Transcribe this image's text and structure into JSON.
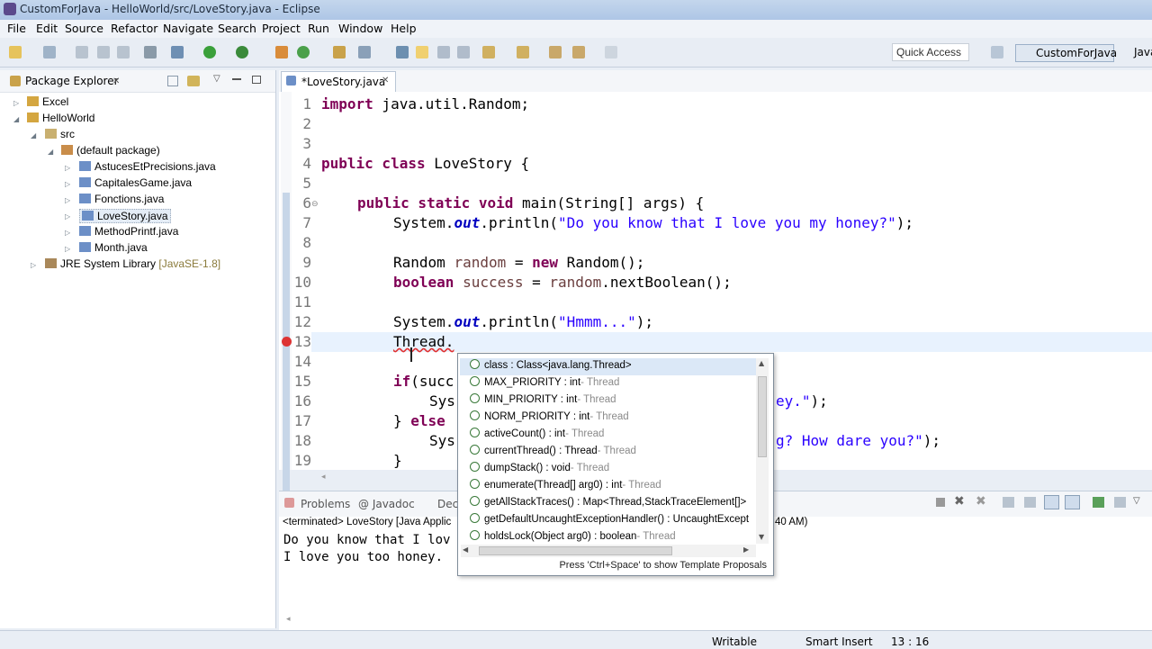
{
  "window": {
    "title": "CustomForJava - HelloWorld/src/LoveStory.java - Eclipse"
  },
  "menu": [
    "File",
    "Edit",
    "Source",
    "Refactor",
    "Navigate",
    "Search",
    "Project",
    "Run",
    "Window",
    "Help"
  ],
  "toolbar": {
    "quick_access": "Quick Access",
    "perspective_active": "CustomForJava",
    "perspective_other": "Java"
  },
  "package_explorer": {
    "tab": "Package Explorer",
    "items": [
      "Excel",
      "HelloWorld",
      "src",
      "(default package)",
      "AstucesEtPrecisions.java",
      "CapitalesGame.java",
      "Fonctions.java",
      "LoveStory.java",
      "MethodPrintf.java",
      "Month.java",
      "JRE System Library"
    ],
    "jre_suffix": "[JavaSE-1.8]"
  },
  "editor": {
    "tab": "*LoveStory.java",
    "line_numbers": [
      "1",
      "2",
      "3",
      "4",
      "5",
      "6",
      "7",
      "8",
      "9",
      "10",
      "11",
      "12",
      "13",
      "14",
      "15",
      "16",
      "17",
      "18",
      "19"
    ],
    "code": {
      "l1_kw": "import",
      "l1_rest": " java.util.Random;",
      "l4_kw": "public class",
      "l4_rest": " LoveStory {",
      "l6_kw": "public static void",
      "l6_rest": " main(String[] args) {",
      "l7_a": "System.",
      "l7_f": "out",
      "l7_b": ".println(",
      "l7_s": "\"Do you know that I love you my honey?\"",
      "l7_c": ");",
      "l9_a": "Random ",
      "l9_v": "random",
      "l9_b": " = ",
      "l9_kw": "new",
      "l9_c": " Random();",
      "l10_kw": "boolean",
      "l10_v": " success",
      "l10_b": " = ",
      "l10_v2": "random",
      "l10_c": ".nextBoolean();",
      "l12_a": "System.",
      "l12_f": "out",
      "l12_b": ".println(",
      "l12_s": "\"Hmmm...\"",
      "l12_c": ");",
      "l13": "Thread.",
      "l15_kw": "if",
      "l15_rest": "(succ",
      "l16_a": "Sys",
      "l16_s": "ey.\"",
      "l16_c": ");",
      "l17_a": "} ",
      "l17_kw": "else",
      "l18_a": "Sys",
      "l18_s": "g? How dare you?\"",
      "l18_c": ");",
      "l19": "}"
    }
  },
  "bottom_panel": {
    "tabs": [
      "Problems",
      "@ Javadoc",
      "Decl"
    ],
    "terminated": "<terminated> LoveStory [Java Applic",
    "terminated_tail": "40 AM)",
    "console_lines": [
      "Do you know that I lov",
      "I love you too honey."
    ]
  },
  "autocomplete": {
    "items": [
      {
        "label": "class : Class<java.lang.Thread>",
        "owner": ""
      },
      {
        "label": "MAX_PRIORITY : int",
        "owner": " - Thread"
      },
      {
        "label": "MIN_PRIORITY : int",
        "owner": " - Thread"
      },
      {
        "label": "NORM_PRIORITY : int",
        "owner": " - Thread"
      },
      {
        "label": "activeCount() : int",
        "owner": " - Thread"
      },
      {
        "label": "currentThread() : Thread",
        "owner": " - Thread"
      },
      {
        "label": "dumpStack() : void",
        "owner": " - Thread"
      },
      {
        "label": "enumerate(Thread[] arg0) : int",
        "owner": " - Thread"
      },
      {
        "label": "getAllStackTraces() : Map<Thread,StackTraceElement[]>",
        "owner": ""
      },
      {
        "label": "getDefaultUncaughtExceptionHandler() : UncaughtExcept",
        "owner": ""
      },
      {
        "label": "holdsLock(Object arg0) : boolean",
        "owner": " - Thread"
      }
    ],
    "hint": "Press 'Ctrl+Space' to show Template Proposals"
  },
  "status": {
    "writable": "Writable",
    "insert_mode": "Smart Insert",
    "position": "13 : 16"
  }
}
